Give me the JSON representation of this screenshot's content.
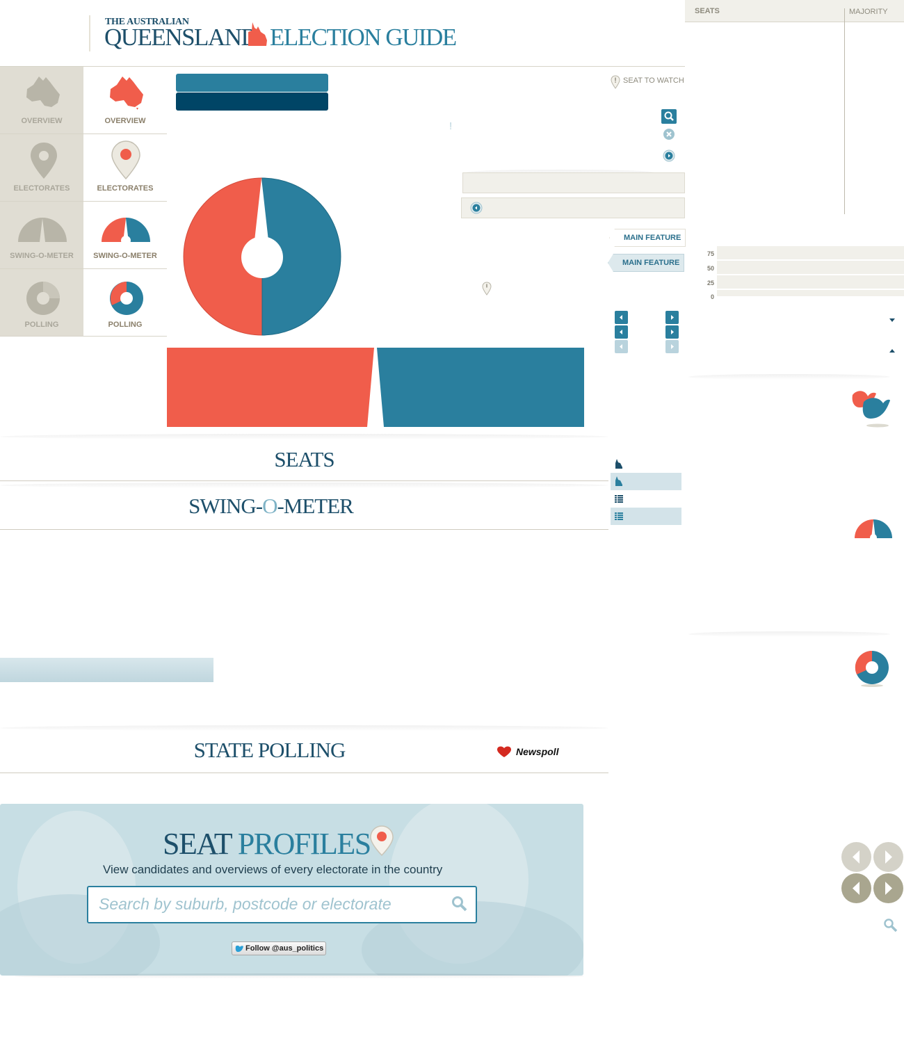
{
  "header": {
    "brand_top": "THE AUSTRALIAN",
    "title_state": "QUEENSLAND",
    "title_rest": "ELECTION GUIDE"
  },
  "nav": {
    "inactive": [
      {
        "label": "OVERVIEW",
        "icon": "australia-map-icon"
      },
      {
        "label": "ELECTORATES",
        "icon": "map-pin-icon"
      },
      {
        "label": "SWING-O-METER",
        "icon": "swing-gauge-icon"
      },
      {
        "label": "POLLING",
        "icon": "donut-chart-icon"
      }
    ],
    "active": [
      {
        "label": "OVERVIEW",
        "icon": "australia-map-icon"
      },
      {
        "label": "ELECTORATES",
        "icon": "map-pin-icon"
      },
      {
        "label": "SWING-O-METER",
        "icon": "swing-gauge-icon"
      },
      {
        "label": "POLLING",
        "icon": "donut-chart-icon"
      }
    ]
  },
  "seats_panel": {
    "seats_label": "SEATS",
    "majority_label": "MAJORITY"
  },
  "seat_to_watch": "SEAT TO WATCH",
  "features": {
    "tab1": "MAIN FEATURE",
    "tab2": "MAIN FEATURE"
  },
  "sections": {
    "seats": "SEATS",
    "swing_1": "SWING-",
    "swing_2": "O",
    "swing_3": "-METER",
    "polling": "STATE POLLING",
    "newspoll": "Newspoll"
  },
  "polling_axis": [
    "75",
    "50",
    "25",
    "0"
  ],
  "seat_profiles": {
    "title_1": "SEAT",
    "title_2": "PROFILES",
    "subtitle": "View candidates and overviews of every electorate in the country",
    "search_placeholder": "Search by suburb, postcode or electorate",
    "follow": "Follow @aus_politics"
  },
  "colors": {
    "red": "#f05d4b",
    "teal": "#2a7f9e",
    "navy": "#004566",
    "beige": "#e0ddd3"
  }
}
